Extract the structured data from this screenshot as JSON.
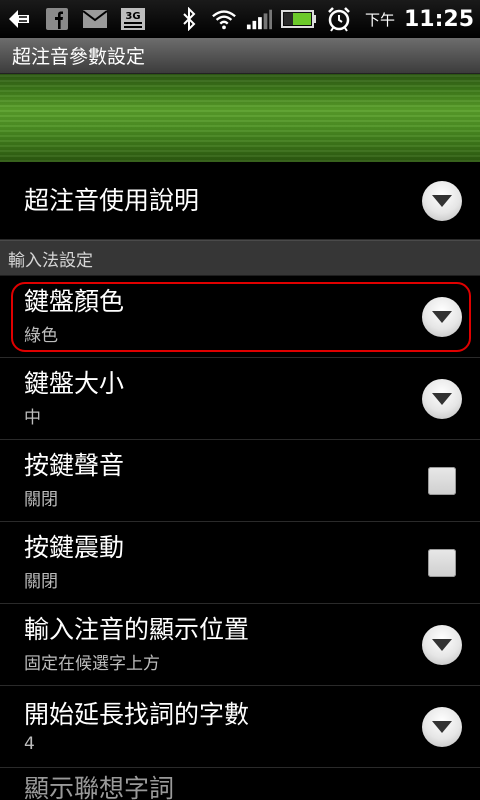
{
  "statusbar": {
    "left_icons": [
      "back-arrow-icon",
      "facebook-icon",
      "gmail-icon",
      "3g-icon"
    ],
    "right_icons": [
      "bluetooth-icon",
      "wifi-icon",
      "signal-icon",
      "battery-icon",
      "alarm-icon"
    ],
    "time_prefix": "下午",
    "time": "11:25"
  },
  "titlebar": {
    "title": "超注音參數設定"
  },
  "items": {
    "help": {
      "title": "超注音使用說明"
    },
    "section_input": {
      "label": "輸入法設定"
    },
    "keyboard_color": {
      "title": "鍵盤顏色",
      "value": "綠色"
    },
    "keyboard_size": {
      "title": "鍵盤大小",
      "value": "中"
    },
    "key_sound": {
      "title": "按鍵聲音",
      "value": "關閉",
      "checked": false
    },
    "key_vibrate": {
      "title": "按鍵震動",
      "value": "關閉",
      "checked": false
    },
    "zhuyin_position": {
      "title": "輸入注音的顯示位置",
      "value": "固定在候選字上方"
    },
    "extend_search_len": {
      "title": "開始延長找詞的字數",
      "value": "4"
    },
    "show_association": {
      "title": "顯示聯想字詞"
    }
  },
  "colors": {
    "highlight": "#e00000",
    "banner_green": "#4e9224"
  }
}
